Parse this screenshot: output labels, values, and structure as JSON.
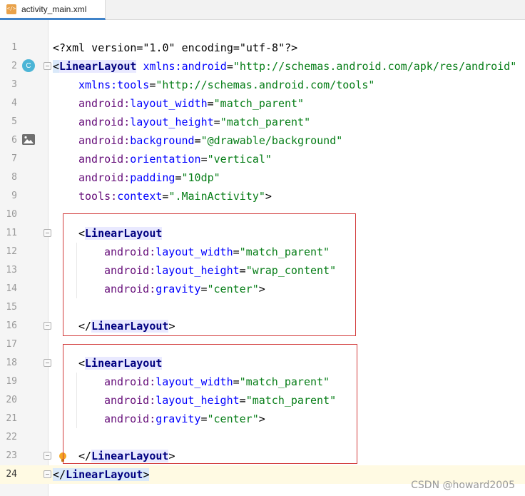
{
  "tab": {
    "filename": "activity_main.xml",
    "icon": "xml-file-icon"
  },
  "lines": [
    {
      "num": "1"
    },
    {
      "num": "2"
    },
    {
      "num": "3"
    },
    {
      "num": "4"
    },
    {
      "num": "5"
    },
    {
      "num": "6"
    },
    {
      "num": "7"
    },
    {
      "num": "8"
    },
    {
      "num": "9"
    },
    {
      "num": "10"
    },
    {
      "num": "11"
    },
    {
      "num": "12"
    },
    {
      "num": "13"
    },
    {
      "num": "14"
    },
    {
      "num": "15"
    },
    {
      "num": "16"
    },
    {
      "num": "17"
    },
    {
      "num": "18"
    },
    {
      "num": "19"
    },
    {
      "num": "20"
    },
    {
      "num": "21"
    },
    {
      "num": "22"
    },
    {
      "num": "23"
    },
    {
      "num": "24"
    }
  ],
  "code": {
    "l1": "<?xml version=\"1.0\" encoding=\"utf-8\"?>",
    "tag_linear": "LinearLayout",
    "xmlns_android": "xmlns:android",
    "xmlns_android_val": "\"http://schemas.android.com/apk/res/android\"",
    "xmlns_tools": "xmlns:tools",
    "xmlns_tools_val": "\"http://schemas.android.com/tools\"",
    "layout_width": "layout_width",
    "layout_height": "layout_height",
    "background": "background",
    "orientation": "orientation",
    "padding": "padding",
    "gravity": "gravity",
    "context": "context",
    "android_prefix": "android:",
    "tools_prefix": "tools:",
    "v_match_parent": "\"match_parent\"",
    "v_wrap_content": "\"wrap_content\"",
    "v_background": "\"@drawable/background\"",
    "v_vertical": "\"vertical\"",
    "v_10dp": "\"10dp\"",
    "v_mainactivity": "\".MainActivity\"",
    "v_center": "\"center\""
  },
  "gutter": {
    "class_badge": "C",
    "class_badge_icon": "class-c-icon",
    "image_icon": "image-preview-icon",
    "bulb_icon": "lightbulb-icon"
  },
  "watermark": "CSDN @howard2005",
  "colors": {
    "tag": "#000080",
    "attr": "#660e7a",
    "value": "#067d17",
    "box": "#d23b3b",
    "current_line": "#fffae3"
  }
}
